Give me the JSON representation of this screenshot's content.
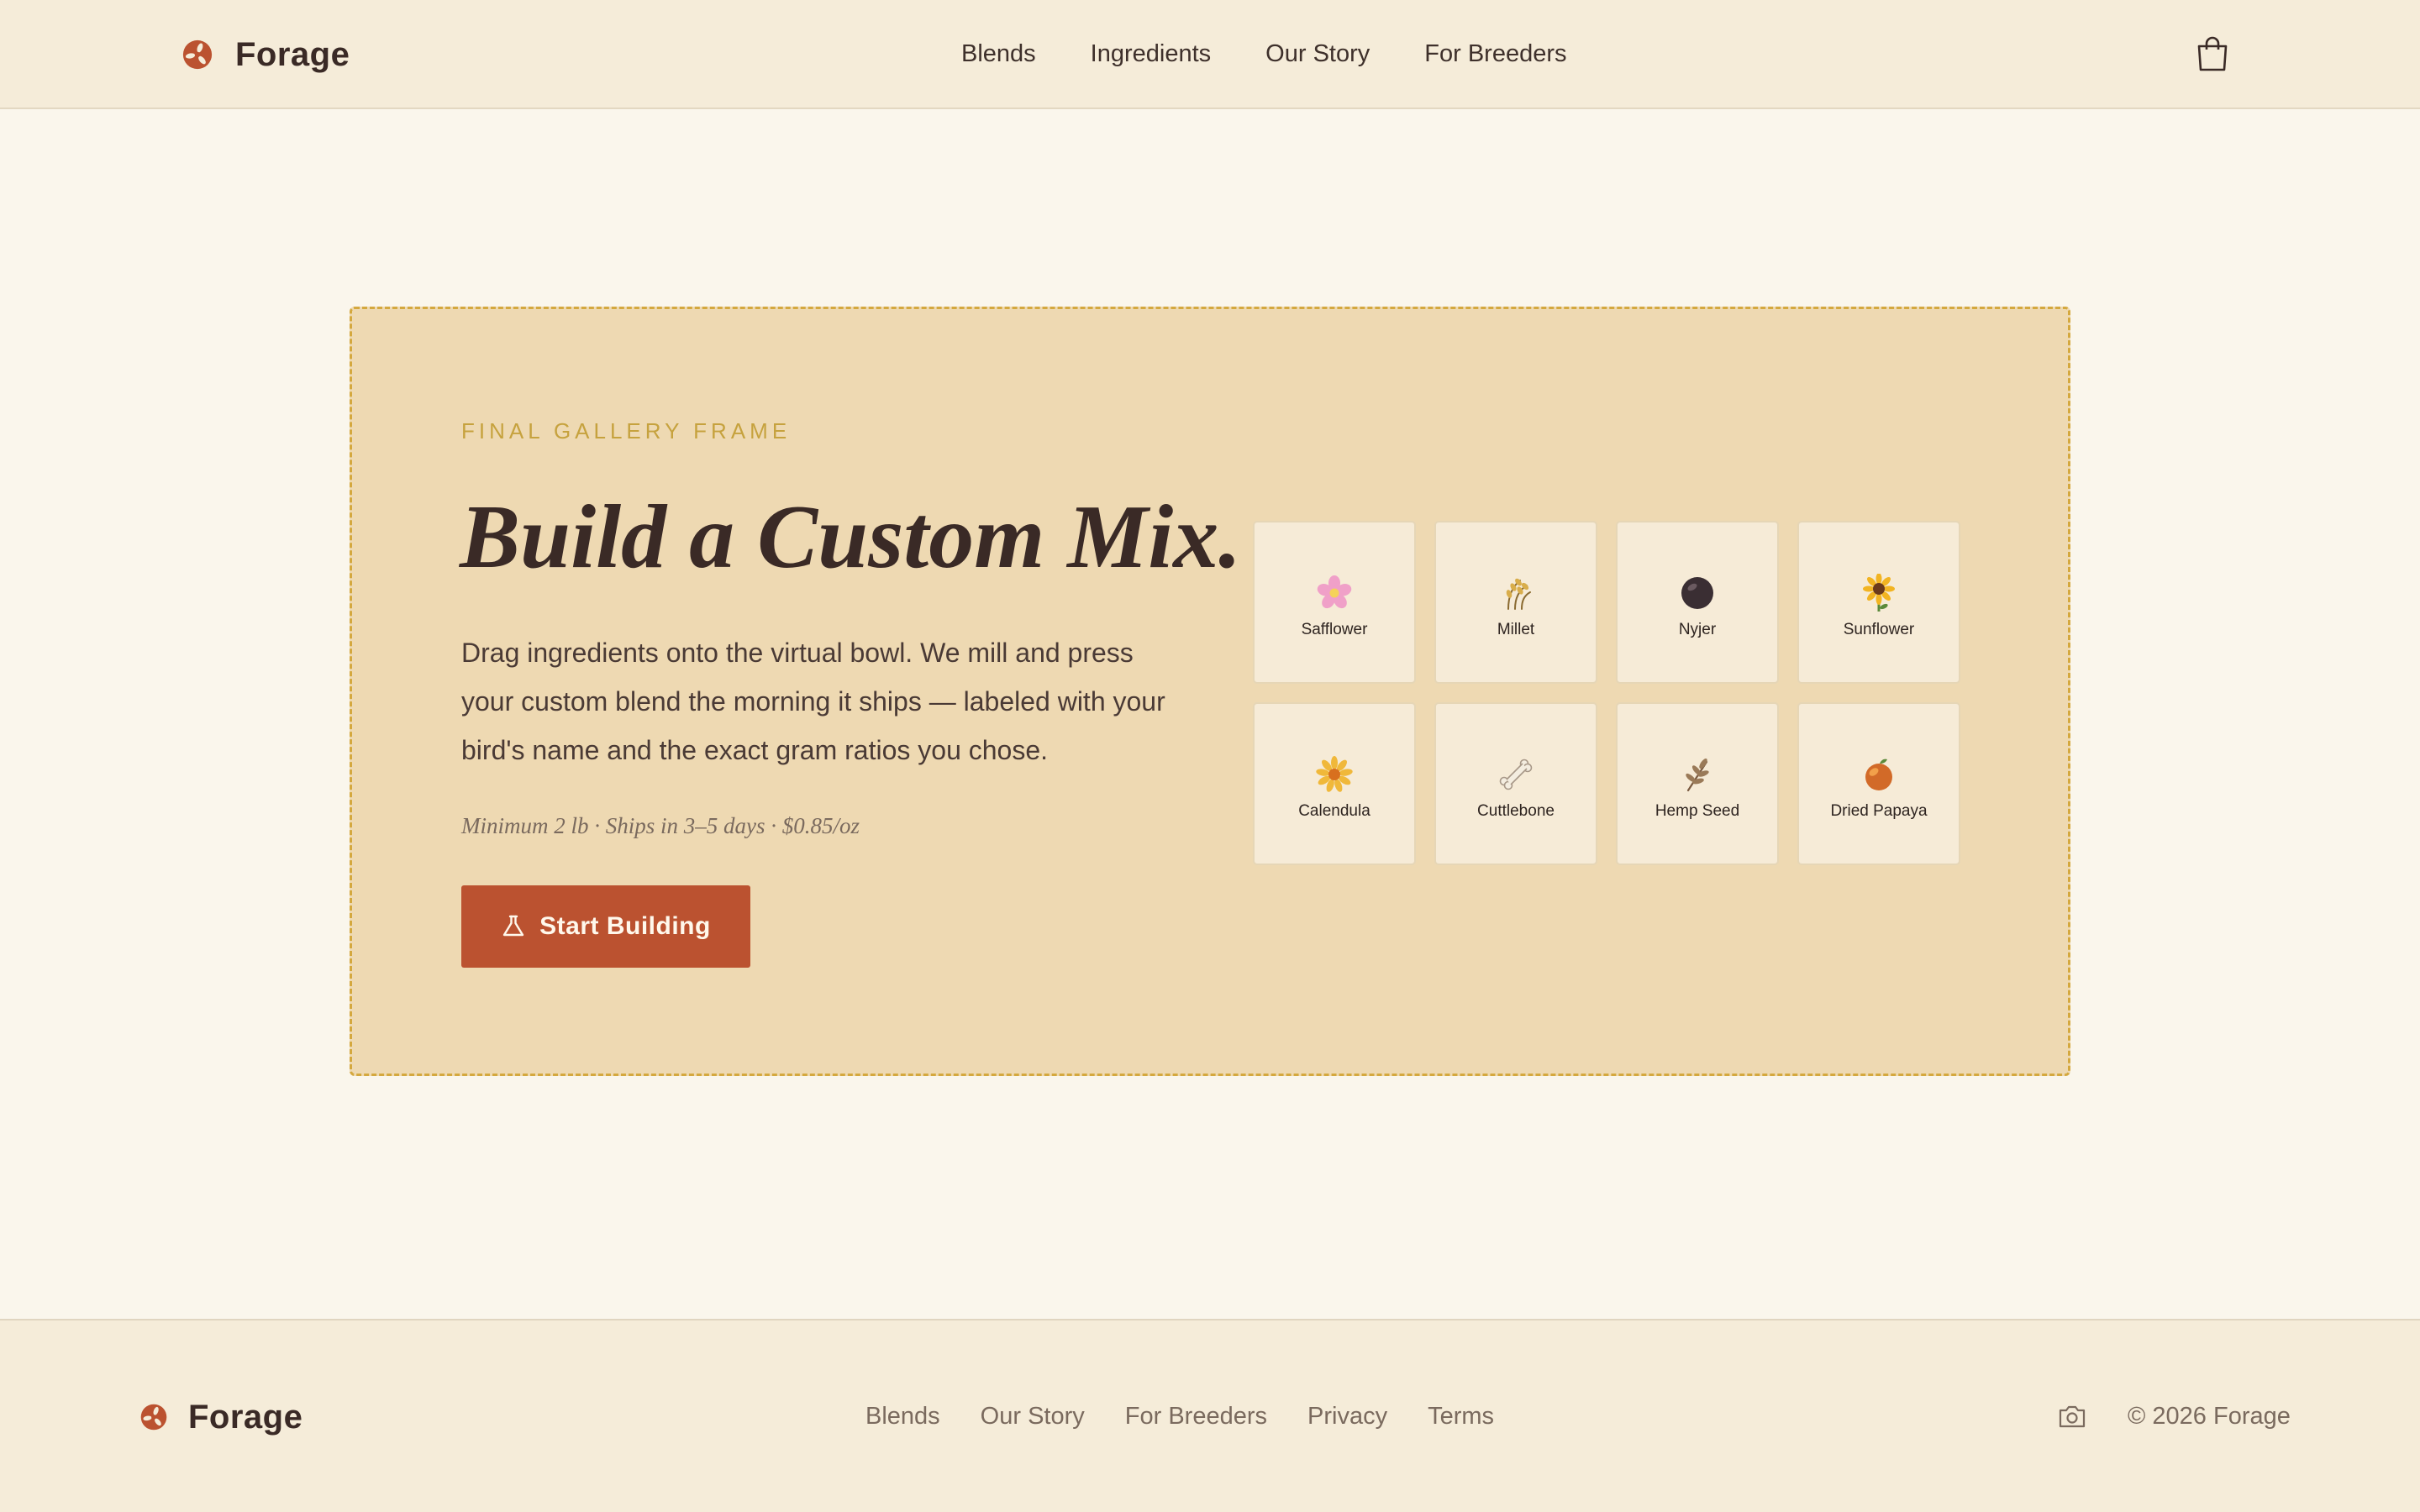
{
  "brand": {
    "name": "Forage",
    "logo_icon": "birdseed-logo-icon",
    "accent": "#bb5230"
  },
  "header": {
    "nav": [
      {
        "label": "Blends"
      },
      {
        "label": "Ingredients"
      },
      {
        "label": "Our Story"
      },
      {
        "label": "For Breeders"
      }
    ],
    "cart_icon": "shopping-bag-icon"
  },
  "hero": {
    "eyebrow": "FINAL GALLERY FRAME",
    "title": "Build a Custom Mix.",
    "description": "Drag ingredients onto the virtual bowl. We mill and press your custom blend the morning it ships — labeled with your bird's name and the exact gram ratios you chose.",
    "meta": "Minimum 2 lb · Ships in 3–5 days · $0.85/oz",
    "cta_label": "Start Building",
    "cta_icon": "flask-icon"
  },
  "ingredients": [
    {
      "label": "Safflower",
      "icon": "pink-flower-icon"
    },
    {
      "label": "Millet",
      "icon": "millet-stalk-icon"
    },
    {
      "label": "Nyjer",
      "icon": "black-seed-icon"
    },
    {
      "label": "Sunflower",
      "icon": "sunflower-icon"
    },
    {
      "label": "Calendula",
      "icon": "calendula-flower-icon"
    },
    {
      "label": "Cuttlebone",
      "icon": "bone-icon"
    },
    {
      "label": "Hemp Seed",
      "icon": "hemp-leaf-icon"
    },
    {
      "label": "Dried Papaya",
      "icon": "papaya-fruit-icon"
    }
  ],
  "footer": {
    "brand": "Forage",
    "nav": [
      {
        "label": "Blends"
      },
      {
        "label": "Our Story"
      },
      {
        "label": "For Breeders"
      },
      {
        "label": "Privacy"
      },
      {
        "label": "Terms"
      }
    ],
    "social_icon": "camera-icon",
    "copyright": "© 2026 Forage"
  }
}
